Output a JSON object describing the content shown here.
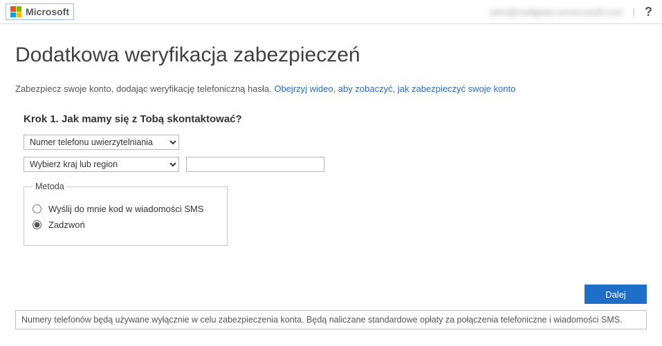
{
  "header": {
    "brand": "Microsoft",
    "account_blurred": "john@mailignite.onmicrosoft.com",
    "help": "?"
  },
  "page": {
    "title": "Dodatkowa weryfikacja zabezpieczeń",
    "desc_text": "Zabezpiecz swoje konto, dodając weryfikację telefoniczną hasła.",
    "desc_link": "Obejrzyj wideo, aby zobaczyć, jak zabezpieczyć swoje konto",
    "step_title": "Krok 1. Jak mamy się z Tobą skontaktować?",
    "method_select": "Numer telefonu uwierzytelniania",
    "region_select": "Wybierz kraj lub region",
    "phone_value": "",
    "fieldset_legend": "Metoda",
    "radio_sms": "Wyślij do mnie kod w wiadomości SMS",
    "radio_call": "Zadzwoń",
    "next_button": "Dalej",
    "notice": "Numery telefonów będą używane wyłącznie w celu zabezpieczenia konta. Będą naliczane standardowe opłaty za połączenia telefoniczne i wiadomości SMS."
  }
}
